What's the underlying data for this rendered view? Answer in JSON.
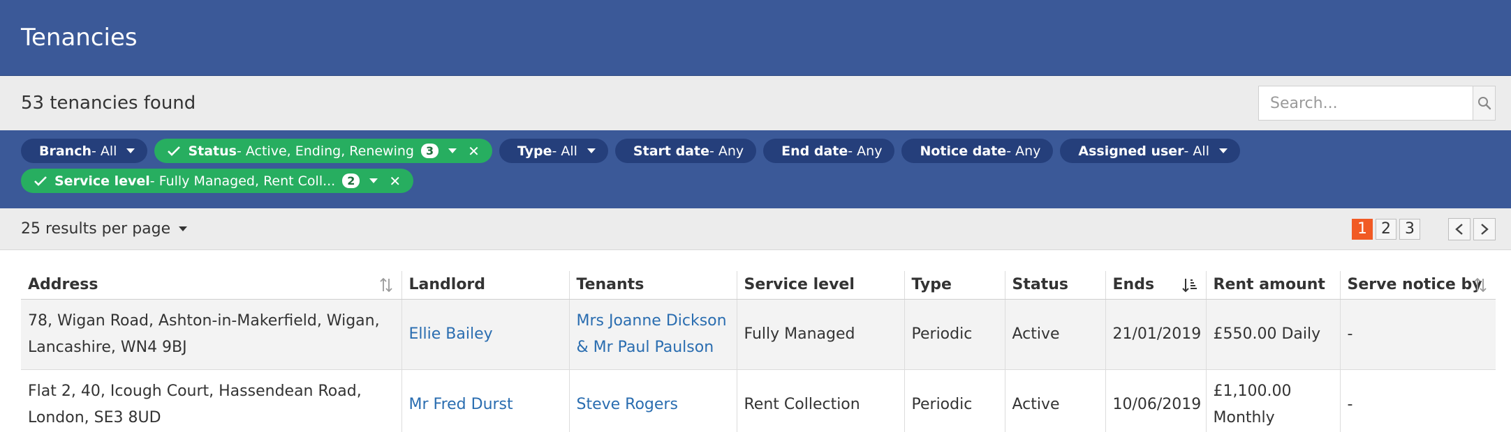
{
  "header": {
    "title": "Tenancies"
  },
  "results": {
    "found_text": "53 tenancies found",
    "search_placeholder": "Search..."
  },
  "filters": {
    "row1": [
      {
        "label": "Branch",
        "value": " - All",
        "active": false
      },
      {
        "label": "Status",
        "value": " - Active, Ending, Renewing",
        "count": "3",
        "active": true
      },
      {
        "label": "Type",
        "value": " - All",
        "active": false
      },
      {
        "label": "Start date",
        "value": " - Any",
        "active": false
      },
      {
        "label": "End date",
        "value": " - Any",
        "active": false
      },
      {
        "label": "Notice date",
        "value": " - Any",
        "active": false
      },
      {
        "label": "Assigned user",
        "value": " - All",
        "active": false
      }
    ],
    "row2": [
      {
        "label": "Service level",
        "value": " - Fully Managed, Rent Coll...",
        "count": "2",
        "active": true
      }
    ]
  },
  "paging": {
    "per_page": "25 results per page",
    "pages": [
      "1",
      "2",
      "3"
    ],
    "current_page": "1"
  },
  "table": {
    "columns": [
      "Address",
      "Landlord",
      "Tenants",
      "Service level",
      "Type",
      "Status",
      "Ends",
      "Rent amount",
      "Serve notice by"
    ],
    "rows": [
      {
        "address": "78, Wigan Road, Ashton-in-Makerfield, Wigan, Lancashire, WN4 9BJ",
        "landlord": "Ellie Bailey",
        "tenants": "Mrs Joanne Dickson & Mr Paul Paulson",
        "service_level": "Fully Managed",
        "type": "Periodic",
        "status": "Active",
        "ends": "21/01/2019",
        "rent": "£550.00 Daily",
        "serve_notice_by": "-"
      },
      {
        "address": "Flat 2, 40, Icough Court, Hassendean Road, London, SE3 8UD",
        "landlord": "Mr Fred Durst",
        "tenants": "Steve Rogers",
        "service_level": "Rent Collection",
        "type": "Periodic",
        "status": "Active",
        "ends": "10/06/2019",
        "rent": "£1,100.00 Monthly",
        "serve_notice_by": "-"
      }
    ]
  },
  "colors": {
    "header_bg": "#3b5998",
    "chip_bg": "#253f7b",
    "chip_active_bg": "#27ae60",
    "current_page_bg": "#f15a24",
    "link": "#2a6db0"
  },
  "icons": {
    "search": "search-icon",
    "check": "check-icon",
    "remove": "close-icon",
    "sort": "sort-icon",
    "sort_desc": "sort-desc-icon",
    "prev": "chevron-left-icon",
    "next": "chevron-right-icon"
  }
}
